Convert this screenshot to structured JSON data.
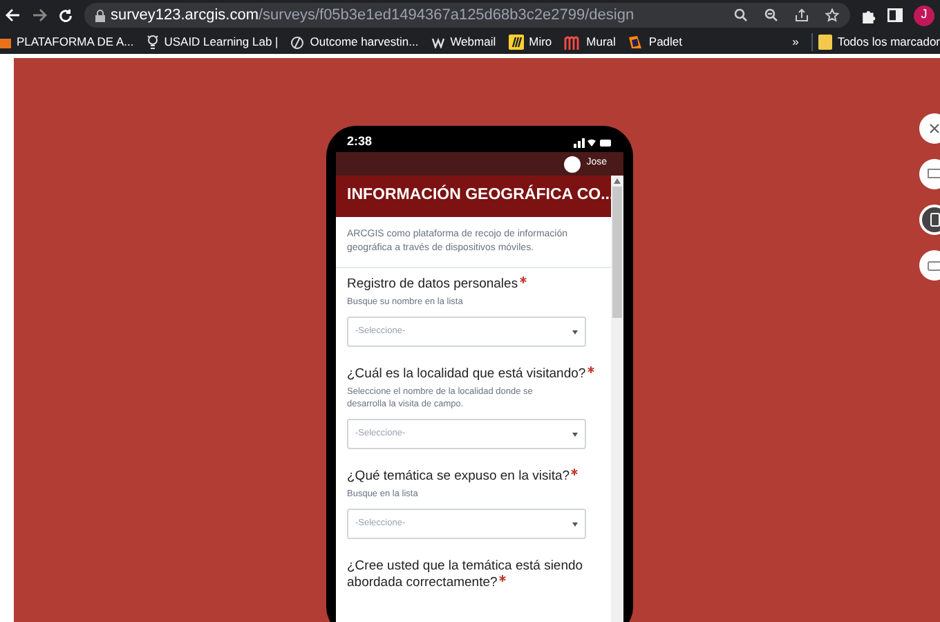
{
  "browser": {
    "url_host": "survey123.arcgis.com",
    "url_path": "/surveys/f05b3e1ed1494367a125d68b3c2e2799/design",
    "avatar_letter": "J"
  },
  "bookmarks": [
    {
      "label": "PLATAFORMA DE A...",
      "kind": "orange"
    },
    {
      "label": "USAID Learning Lab |",
      "kind": "bulb"
    },
    {
      "label": "Outcome harvestin...",
      "kind": "slash"
    },
    {
      "label": "Webmail",
      "kind": "w"
    },
    {
      "label": "Miro",
      "kind": "miro"
    },
    {
      "label": "Mural",
      "kind": "mural"
    },
    {
      "label": "Padlet",
      "kind": "padlet"
    }
  ],
  "bookmarks_more": "»",
  "bookmarks_folder": "Todos los marcador",
  "phone": {
    "time": "2:38",
    "user": "Jose",
    "title": "INFORMACIÓN GEOGRÁFICA CO...",
    "description": "ARCGIS como plataforma de recojo de información geográfica a través de dispositivos móviles.",
    "questions": [
      {
        "label": "Registro de datos personales",
        "required": true,
        "hint": "Busque su nombre en la lista",
        "placeholder": "-Seleccione-"
      },
      {
        "label": "¿Cuál es la localidad que está visitando?",
        "required": true,
        "hint": "Seleccione el nombre de la localidad donde se desarrolla la visita de campo.",
        "placeholder": "-Seleccione-"
      },
      {
        "label": "¿Qué temática se expuso en la visita?",
        "required": true,
        "hint": "Busque en la lista",
        "placeholder": "-Seleccione-"
      },
      {
        "label": "¿Cree usted que la temática está siendo abordada correctamente?",
        "required": true
      }
    ]
  },
  "preview_tools": [
    {
      "kind": "close",
      "selected": false
    },
    {
      "kind": "desktop",
      "selected": false
    },
    {
      "kind": "phone",
      "selected": true
    },
    {
      "kind": "tablet",
      "selected": false
    }
  ]
}
